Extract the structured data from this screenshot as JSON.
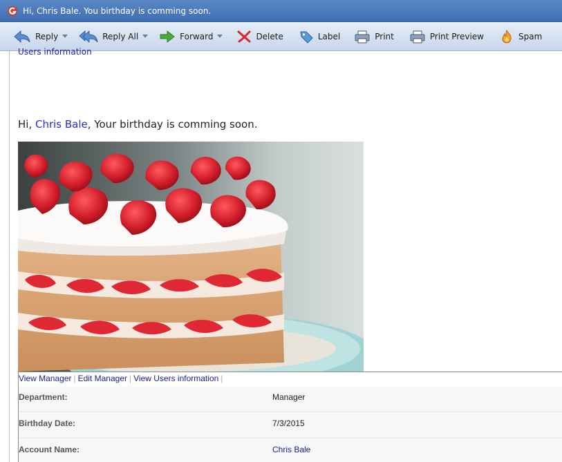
{
  "window": {
    "title": "Hi, Chris Bale. You birthday is comming soon."
  },
  "toolbar": {
    "buttons": [
      {
        "label": "Reply",
        "icon": "reply-icon",
        "dropdown": true
      },
      {
        "label": "Reply All",
        "icon": "reply-all-icon",
        "dropdown": true
      },
      {
        "label": "Forward",
        "icon": "forward-icon",
        "dropdown": true
      },
      {
        "label": "Delete",
        "icon": "delete-icon",
        "dropdown": false
      },
      {
        "label": "Label",
        "icon": "label-icon",
        "dropdown": false
      },
      {
        "label": "Print",
        "icon": "print-icon",
        "dropdown": false
      },
      {
        "label": "Print Preview",
        "icon": "print-preview-icon",
        "dropdown": false
      },
      {
        "label": "Spam",
        "icon": "spam-icon",
        "dropdown": false
      }
    ]
  },
  "message": {
    "clipped_link": "Users information",
    "greeting_prefix": "Hi, ",
    "greeting_name": "Chris Bale",
    "greeting_suffix": ", Your birthday is comming soon.",
    "image_icon": "strawberry-cake-photo"
  },
  "user_links": [
    "View Manager",
    "Edit Manager",
    "View Users information"
  ],
  "link_separator": "|",
  "user_info": [
    {
      "label": "Department:",
      "value": "Manager",
      "is_link": false
    },
    {
      "label": "Birthday Date:",
      "value": "7/3/2015",
      "is_link": false
    },
    {
      "label": "Account Name:",
      "value": "Chris Bale",
      "is_link": true
    }
  ],
  "colors": {
    "titlebar": "#4a78b8",
    "link": "#1a1a9a",
    "greeting_name": "#2a2acd"
  }
}
